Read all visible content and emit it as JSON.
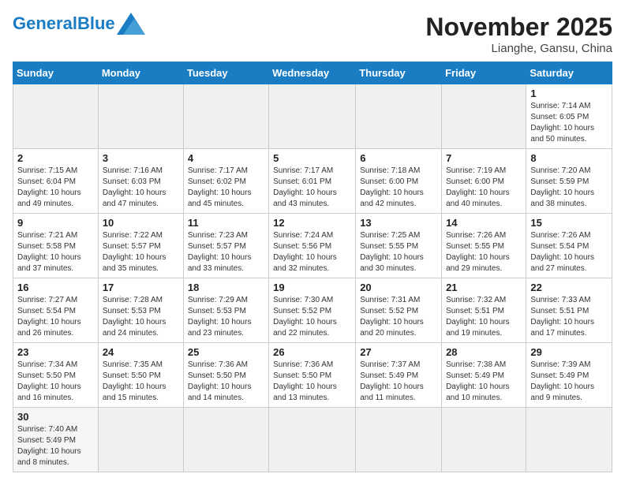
{
  "header": {
    "logo_general": "General",
    "logo_blue": "Blue",
    "month_title": "November 2025",
    "location": "Lianghe, Gansu, China"
  },
  "days_of_week": [
    "Sunday",
    "Monday",
    "Tuesday",
    "Wednesday",
    "Thursday",
    "Friday",
    "Saturday"
  ],
  "weeks": [
    [
      {
        "day": "",
        "info": "",
        "empty": true
      },
      {
        "day": "",
        "info": "",
        "empty": true
      },
      {
        "day": "",
        "info": "",
        "empty": true
      },
      {
        "day": "",
        "info": "",
        "empty": true
      },
      {
        "day": "",
        "info": "",
        "empty": true
      },
      {
        "day": "",
        "info": "",
        "empty": true
      },
      {
        "day": "1",
        "info": "Sunrise: 7:14 AM\nSunset: 6:05 PM\nDaylight: 10 hours\nand 50 minutes."
      }
    ],
    [
      {
        "day": "2",
        "info": "Sunrise: 7:15 AM\nSunset: 6:04 PM\nDaylight: 10 hours\nand 49 minutes."
      },
      {
        "day": "3",
        "info": "Sunrise: 7:16 AM\nSunset: 6:03 PM\nDaylight: 10 hours\nand 47 minutes."
      },
      {
        "day": "4",
        "info": "Sunrise: 7:17 AM\nSunset: 6:02 PM\nDaylight: 10 hours\nand 45 minutes."
      },
      {
        "day": "5",
        "info": "Sunrise: 7:17 AM\nSunset: 6:01 PM\nDaylight: 10 hours\nand 43 minutes."
      },
      {
        "day": "6",
        "info": "Sunrise: 7:18 AM\nSunset: 6:00 PM\nDaylight: 10 hours\nand 42 minutes."
      },
      {
        "day": "7",
        "info": "Sunrise: 7:19 AM\nSunset: 6:00 PM\nDaylight: 10 hours\nand 40 minutes."
      },
      {
        "day": "8",
        "info": "Sunrise: 7:20 AM\nSunset: 5:59 PM\nDaylight: 10 hours\nand 38 minutes."
      }
    ],
    [
      {
        "day": "9",
        "info": "Sunrise: 7:21 AM\nSunset: 5:58 PM\nDaylight: 10 hours\nand 37 minutes."
      },
      {
        "day": "10",
        "info": "Sunrise: 7:22 AM\nSunset: 5:57 PM\nDaylight: 10 hours\nand 35 minutes."
      },
      {
        "day": "11",
        "info": "Sunrise: 7:23 AM\nSunset: 5:57 PM\nDaylight: 10 hours\nand 33 minutes."
      },
      {
        "day": "12",
        "info": "Sunrise: 7:24 AM\nSunset: 5:56 PM\nDaylight: 10 hours\nand 32 minutes."
      },
      {
        "day": "13",
        "info": "Sunrise: 7:25 AM\nSunset: 5:55 PM\nDaylight: 10 hours\nand 30 minutes."
      },
      {
        "day": "14",
        "info": "Sunrise: 7:26 AM\nSunset: 5:55 PM\nDaylight: 10 hours\nand 29 minutes."
      },
      {
        "day": "15",
        "info": "Sunrise: 7:26 AM\nSunset: 5:54 PM\nDaylight: 10 hours\nand 27 minutes."
      }
    ],
    [
      {
        "day": "16",
        "info": "Sunrise: 7:27 AM\nSunset: 5:54 PM\nDaylight: 10 hours\nand 26 minutes."
      },
      {
        "day": "17",
        "info": "Sunrise: 7:28 AM\nSunset: 5:53 PM\nDaylight: 10 hours\nand 24 minutes."
      },
      {
        "day": "18",
        "info": "Sunrise: 7:29 AM\nSunset: 5:53 PM\nDaylight: 10 hours\nand 23 minutes."
      },
      {
        "day": "19",
        "info": "Sunrise: 7:30 AM\nSunset: 5:52 PM\nDaylight: 10 hours\nand 22 minutes."
      },
      {
        "day": "20",
        "info": "Sunrise: 7:31 AM\nSunset: 5:52 PM\nDaylight: 10 hours\nand 20 minutes."
      },
      {
        "day": "21",
        "info": "Sunrise: 7:32 AM\nSunset: 5:51 PM\nDaylight: 10 hours\nand 19 minutes."
      },
      {
        "day": "22",
        "info": "Sunrise: 7:33 AM\nSunset: 5:51 PM\nDaylight: 10 hours\nand 17 minutes."
      }
    ],
    [
      {
        "day": "23",
        "info": "Sunrise: 7:34 AM\nSunset: 5:50 PM\nDaylight: 10 hours\nand 16 minutes."
      },
      {
        "day": "24",
        "info": "Sunrise: 7:35 AM\nSunset: 5:50 PM\nDaylight: 10 hours\nand 15 minutes."
      },
      {
        "day": "25",
        "info": "Sunrise: 7:36 AM\nSunset: 5:50 PM\nDaylight: 10 hours\nand 14 minutes."
      },
      {
        "day": "26",
        "info": "Sunrise: 7:36 AM\nSunset: 5:50 PM\nDaylight: 10 hours\nand 13 minutes."
      },
      {
        "day": "27",
        "info": "Sunrise: 7:37 AM\nSunset: 5:49 PM\nDaylight: 10 hours\nand 11 minutes."
      },
      {
        "day": "28",
        "info": "Sunrise: 7:38 AM\nSunset: 5:49 PM\nDaylight: 10 hours\nand 10 minutes."
      },
      {
        "day": "29",
        "info": "Sunrise: 7:39 AM\nSunset: 5:49 PM\nDaylight: 10 hours\nand 9 minutes."
      }
    ],
    [
      {
        "day": "30",
        "info": "Sunrise: 7:40 AM\nSunset: 5:49 PM\nDaylight: 10 hours\nand 8 minutes."
      },
      {
        "day": "",
        "info": "",
        "empty": true
      },
      {
        "day": "",
        "info": "",
        "empty": true
      },
      {
        "day": "",
        "info": "",
        "empty": true
      },
      {
        "day": "",
        "info": "",
        "empty": true
      },
      {
        "day": "",
        "info": "",
        "empty": true
      },
      {
        "day": "",
        "info": "",
        "empty": true
      }
    ]
  ]
}
